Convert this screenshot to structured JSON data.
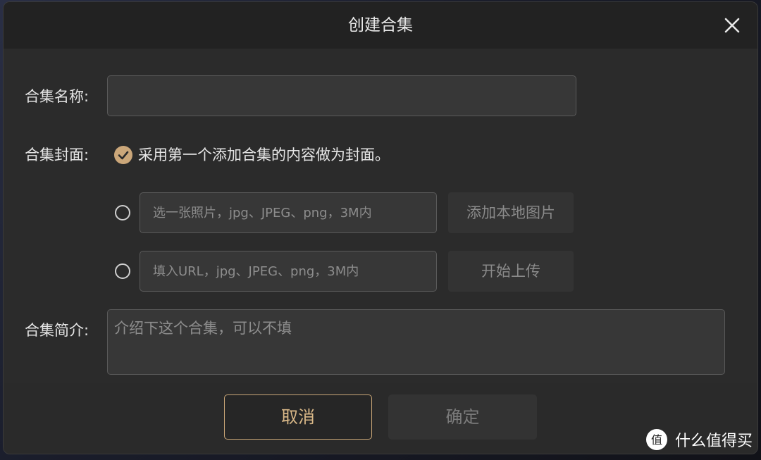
{
  "dialog": {
    "title": "创建合集"
  },
  "form": {
    "name_label": "合集名称:",
    "name_value": "",
    "cover_label": "合集封面:",
    "cover_default_option": "采用第一个添加合集的内容做为封面。",
    "cover_local_placeholder": "选一张照片，jpg、JPEG、png，3M内",
    "cover_local_button": "添加本地图片",
    "cover_url_placeholder": "填入URL，jpg、JPEG、png，3M内",
    "cover_url_button": "开始上传",
    "desc_label": "合集简介:",
    "desc_placeholder": "介绍下这个合集，可以不填"
  },
  "footer": {
    "cancel_label": "取消",
    "ok_label": "确定"
  },
  "watermark": {
    "text": "什么值得买",
    "logo_glyph": "值"
  },
  "colors": {
    "accent": "#cba77a",
    "dialog_bg": "#2b2b2b",
    "header_bg": "#222222"
  }
}
